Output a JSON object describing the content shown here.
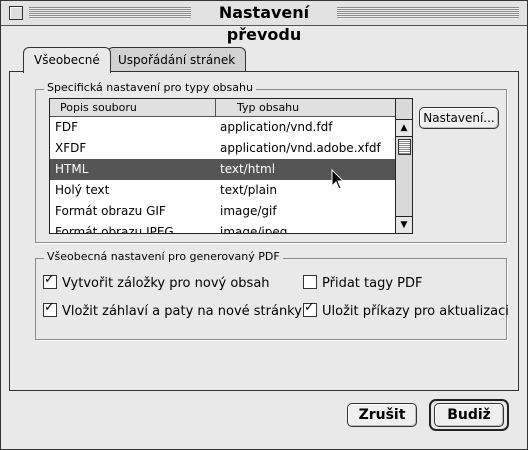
{
  "window": {
    "title": "Nastavení převodu"
  },
  "tabs": [
    {
      "label": "Všeobecné",
      "active": true
    },
    {
      "label": "Uspořádání stránek",
      "active": false
    }
  ],
  "content_group": {
    "label": "Specifická nastavení pro typy obsahu",
    "columns": [
      "Popis souboru",
      "Typ obsahu"
    ],
    "rows": [
      {
        "name": "FDF",
        "type": "application/vnd.fdf",
        "selected": false
      },
      {
        "name": "XFDF",
        "type": "application/vnd.adobe.xfdf",
        "selected": false
      },
      {
        "name": "HTML",
        "type": "text/html",
        "selected": true
      },
      {
        "name": "Holý text",
        "type": "text/plain",
        "selected": false
      },
      {
        "name": "Formát obrazu GIF",
        "type": "image/gif",
        "selected": false
      },
      {
        "name": "Formát obrazu JPEG",
        "type": "image/jpeg",
        "selected": false
      }
    ],
    "settings_button": "Nastavení..."
  },
  "pdf_group": {
    "label": "Všeobecná nastavení pro generovaný PDF",
    "options": [
      {
        "label": "Vytvořit záložky pro nový obsah",
        "checked": true
      },
      {
        "label": "Přidat tagy PDF",
        "checked": false
      },
      {
        "label": "Vložit záhlaví a paty na nové stránky",
        "checked": true
      },
      {
        "label": "Uložit příkazy pro aktualizaci",
        "checked": true
      }
    ]
  },
  "buttons": {
    "cancel": "Zrušit",
    "ok": "Budiž"
  },
  "icons": {
    "checkmark": "✓"
  }
}
